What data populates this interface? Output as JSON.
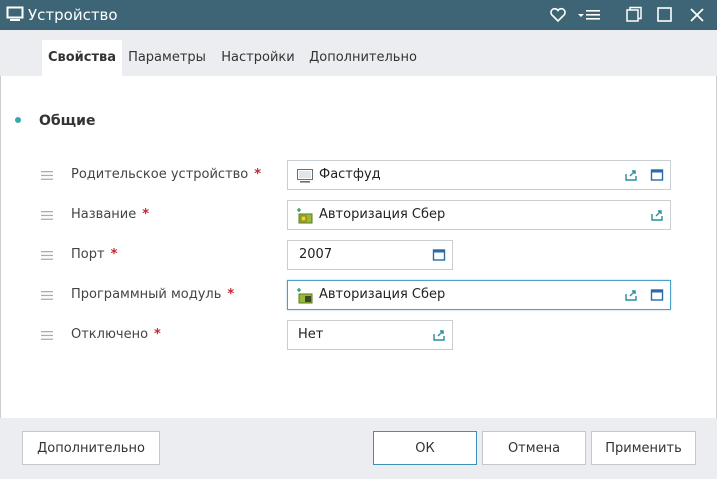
{
  "window": {
    "title": "Устройство"
  },
  "tabs": [
    {
      "label": "Свойства"
    },
    {
      "label": "Параметры"
    },
    {
      "label": "Настройки"
    },
    {
      "label": "Дополнительно"
    }
  ],
  "section": {
    "title": "Общие"
  },
  "fields": {
    "parent": {
      "label": "Родительское устройство",
      "required": "*",
      "value": "Фастфуд"
    },
    "name": {
      "label": "Название",
      "required": "*",
      "value": "Авторизация Сбер"
    },
    "port": {
      "label": "Порт",
      "required": "*",
      "value": "2007"
    },
    "module": {
      "label": "Программный модуль",
      "required": "*",
      "value": "Авторизация Сбер"
    },
    "disabled": {
      "label": "Отключено",
      "required": "*",
      "value": "Нет"
    }
  },
  "buttons": {
    "advanced": "Дополнительно",
    "ok": "ОК",
    "cancel": "Отмена",
    "apply": "Применить"
  },
  "colors": {
    "titlebar": "#3d6575",
    "accent": "#3aa8a8",
    "required": "#c0272d",
    "panel": "#ebedf0"
  }
}
